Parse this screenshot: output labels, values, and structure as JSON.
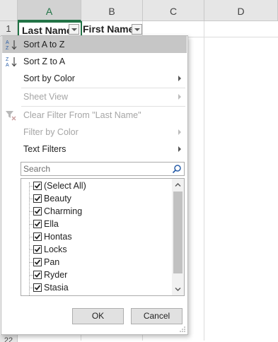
{
  "sheet": {
    "columns": [
      "A",
      "B",
      "C",
      "D"
    ],
    "rows": [
      "1",
      "22"
    ],
    "cells": {
      "a1": "Last Name",
      "b1": "First Name"
    }
  },
  "menu": {
    "items": [
      {
        "label": "Sort A to Z",
        "state": "highlighted",
        "icon": "sort-a-to-z-icon"
      },
      {
        "label": "Sort Z to A",
        "state": "enabled",
        "icon": "sort-z-to-a-icon"
      },
      {
        "label": "Sort by Color",
        "state": "enabled",
        "submenu": true
      },
      {
        "label": "Sheet View",
        "state": "disabled",
        "submenu": true
      },
      {
        "label": "Clear Filter From \"Last Name\"",
        "state": "disabled",
        "icon": "clear-filter-icon"
      },
      {
        "label": "Filter by Color",
        "state": "disabled",
        "submenu": true
      },
      {
        "label": "Text Filters",
        "state": "enabled",
        "submenu": true
      }
    ],
    "search_placeholder": "Search",
    "values": [
      {
        "label": "(Select All)",
        "checked": true
      },
      {
        "label": "Beauty",
        "checked": true
      },
      {
        "label": "Charming",
        "checked": true
      },
      {
        "label": "Ella",
        "checked": true
      },
      {
        "label": "Hontas",
        "checked": true
      },
      {
        "label": "Locks",
        "checked": true
      },
      {
        "label": "Pan",
        "checked": true
      },
      {
        "label": "Ryder",
        "checked": true
      },
      {
        "label": "Stasia",
        "checked": true
      }
    ],
    "ok_label": "OK",
    "cancel_label": "Cancel"
  },
  "colors": {
    "accent": "#217346",
    "highlight": "#c6c6c6",
    "disabled": "#a5a5a5"
  }
}
